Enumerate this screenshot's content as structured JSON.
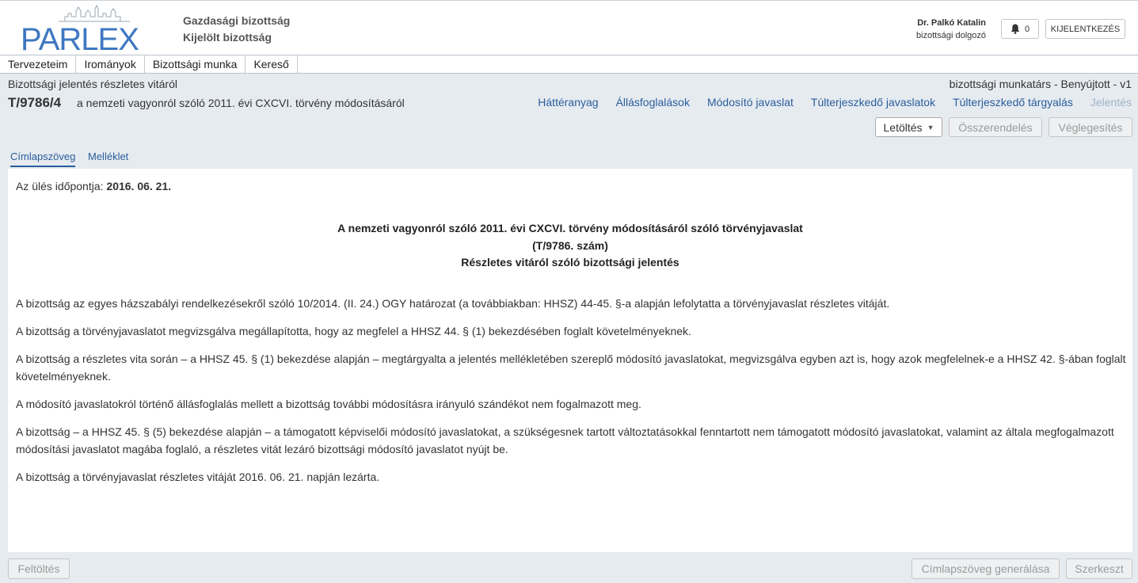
{
  "app": {
    "logo_text": "PARLEX",
    "committee_line1": "Gazdasági bizottság",
    "committee_line2": "Kijelölt bizottság"
  },
  "user": {
    "name": "Dr. Palkó Katalin",
    "role": "bizottsági dolgozó",
    "notifications": "0",
    "logout_label": "KIJELENTKEZÉS"
  },
  "menu": {
    "items": [
      {
        "label": "Tervezeteim"
      },
      {
        "label": "Irományok"
      },
      {
        "label": "Bizottsági munka"
      },
      {
        "label": "Kereső"
      }
    ]
  },
  "document": {
    "type": "Bizottsági jelentés részletes vitáról",
    "role_status": "bizottsági munkatárs - Benyújtott - v1",
    "id": "T/9786/4",
    "title": "a nemzeti vagyonról szóló 2011. évi CXCVI. törvény módosításáról",
    "links": [
      {
        "label": "Háttéranyag"
      },
      {
        "label": "Állásfoglalások"
      },
      {
        "label": "Módosító javaslat"
      },
      {
        "label": "Túlterjeszkedő javaslatok"
      },
      {
        "label": "Túlterjeszkedő tárgyalás"
      },
      {
        "label": "Jelentés"
      }
    ]
  },
  "actions": {
    "download_label": "Letöltés",
    "assign_label": "Összerendelés",
    "finalize_label": "Véglegesítés"
  },
  "tabs": [
    {
      "label": "Címlapszöveg"
    },
    {
      "label": "Melléklet"
    }
  ],
  "content": {
    "meeting_label": "Az ülés időpontja: ",
    "meeting_date": "2016. 06. 21.",
    "title_line1": "A nemzeti vagyonról szóló 2011. évi CXCVI. törvény módosításáról szóló törvényjavaslat",
    "title_line2": "(T/9786. szám)",
    "title_line3": "Részletes vitáról szóló bizottsági jelentés",
    "paragraphs": [
      "A bizottság az egyes házszabályi rendelkezésekről szóló 10/2014. (II. 24.) OGY határozat (a továbbiakban: HHSZ) 44-45. §-a alapján lefolytatta a törvényjavaslat részletes vitáját.",
      "A bizottság a törvényjavaslatot megvizsgálva megállapította, hogy az megfelel a HHSZ 44. § (1) bekezdésében foglalt követelményeknek.",
      "A bizottság a részletes vita során – a HHSZ 45. § (1) bekezdése alapján – megtárgyalta a jelentés mellékletében szereplő módosító javaslatokat, megvizsgálva egyben azt is, hogy azok megfelelnek-e a HHSZ 42. §-ában foglalt követelményeknek.",
      "A módosító javaslatokról történő állásfoglalás mellett a bizottság további módosításra irányuló szándékot nem fogalmazott meg.",
      "A bizottság – a HHSZ 45. § (5) bekezdése alapján – a támogatott képviselői módosító javaslatokat, a szükségesnek tartott változtatásokkal fenntartott nem támogatott módosító javaslatokat, valamint az általa megfogalmazott módosítási javaslatot magába foglaló, a részletes vitát lezáró bizottsági módosító javaslatot nyújt be.",
      "A bizottság a törvényjavaslat részletes vitáját 2016. 06. 21. napján lezárta."
    ]
  },
  "footer": {
    "upload_label": "Feltöltés",
    "generate_label": "Címlapszöveg generálása",
    "edit_label": "Szerkeszt"
  },
  "colors": {
    "link": "#2a5d9b",
    "logo_blue": "#3f78c1",
    "background": "#e6ebf0"
  }
}
